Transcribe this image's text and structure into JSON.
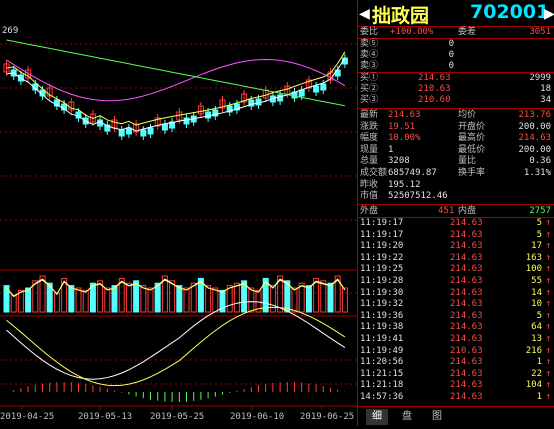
{
  "chart": {
    "indicator_value": "269",
    "dates": [
      "2019-04-25",
      "2019-05-13",
      "2019-05-25",
      "2019-06-10",
      "2019-06-25"
    ],
    "colors": {
      "up": "#ff3c3c",
      "down": "#54ffff",
      "ma5": "#ffffff",
      "ma10": "#ffff54",
      "ma20": "#ff54ff",
      "ma60": "#54ff54",
      "grid": "#a00000"
    }
  },
  "panel": {
    "name": "拙政园",
    "code": "702001",
    "left_arrow": "◀",
    "right_arrow": "▶",
    "weibi": {
      "label": "委比",
      "value": "+100.00%",
      "label2": "委差",
      "value2": "3051"
    },
    "sells": [
      {
        "label": "卖⑤",
        "price": "",
        "vol": "0"
      },
      {
        "label": "卖④",
        "price": "",
        "vol": "0"
      },
      {
        "label": "卖③",
        "price": "",
        "vol": "0"
      }
    ],
    "buys": [
      {
        "label": "买①",
        "price": "214.63",
        "vol": "2999"
      },
      {
        "label": "买②",
        "price": "210.63",
        "vol": "18"
      },
      {
        "label": "买③",
        "price": "210.60",
        "vol": "34"
      }
    ],
    "quote": [
      {
        "l": "最新",
        "v": "214.63",
        "l2": "均价",
        "v2": "213.76"
      },
      {
        "l": "涨跌",
        "v": "19.51",
        "l2": "开盘价",
        "v2": "200.00"
      },
      {
        "l": "幅度",
        "v": "10.00%",
        "l2": "最高价",
        "v2": "214.63"
      },
      {
        "l": "现量",
        "v": "1",
        "l2": "最低价",
        "v2": "200.00"
      },
      {
        "l": "总量",
        "v": "3208",
        "l2": "量比",
        "v2": "0.36"
      },
      {
        "l": "成交额",
        "v": "685749.87",
        "l2": "换手率",
        "v2": "1.31%"
      },
      {
        "l": "昨收",
        "v": "195.12",
        "l2": "",
        "v2": ""
      },
      {
        "l": "市值",
        "v": "52507512.46",
        "l2": "",
        "v2": ""
      }
    ],
    "outer": {
      "label": "外盘",
      "value": "451",
      "label2": "内盘",
      "value2": "2757"
    },
    "ticks": [
      {
        "t": "11:19:17",
        "p": "214.63",
        "v": "5",
        "d": "↑"
      },
      {
        "t": "11:19:17",
        "p": "214.63",
        "v": "5",
        "d": "↑"
      },
      {
        "t": "11:19:20",
        "p": "214.63",
        "v": "17",
        "d": "↑"
      },
      {
        "t": "11:19:22",
        "p": "214.63",
        "v": "163",
        "d": "↑"
      },
      {
        "t": "11:19:25",
        "p": "214.63",
        "v": "100",
        "d": "↑"
      },
      {
        "t": "11:19:28",
        "p": "214.63",
        "v": "55",
        "d": "↑"
      },
      {
        "t": "11:19:30",
        "p": "214.63",
        "v": "14",
        "d": "↑"
      },
      {
        "t": "11:19:32",
        "p": "214.63",
        "v": "10",
        "d": "↑"
      },
      {
        "t": "11:19:36",
        "p": "214.63",
        "v": "5",
        "d": "↑"
      },
      {
        "t": "11:19:38",
        "p": "214.63",
        "v": "64",
        "d": "↑"
      },
      {
        "t": "11:19:41",
        "p": "214.63",
        "v": "13",
        "d": "↑"
      },
      {
        "t": "11:19:49",
        "p": "210.63",
        "v": "216",
        "d": "↑"
      },
      {
        "t": "11:20:56",
        "p": "214.63",
        "v": "1",
        "d": "↑"
      },
      {
        "t": "11:21:15",
        "p": "214.63",
        "v": "22",
        "d": "↑"
      },
      {
        "t": "11:21:18",
        "p": "214.63",
        "v": "104",
        "d": "↑"
      },
      {
        "t": "14:57:36",
        "p": "214.63",
        "v": "1",
        "d": "↑"
      }
    ],
    "tabs": [
      "细",
      "盘",
      "图"
    ]
  }
}
